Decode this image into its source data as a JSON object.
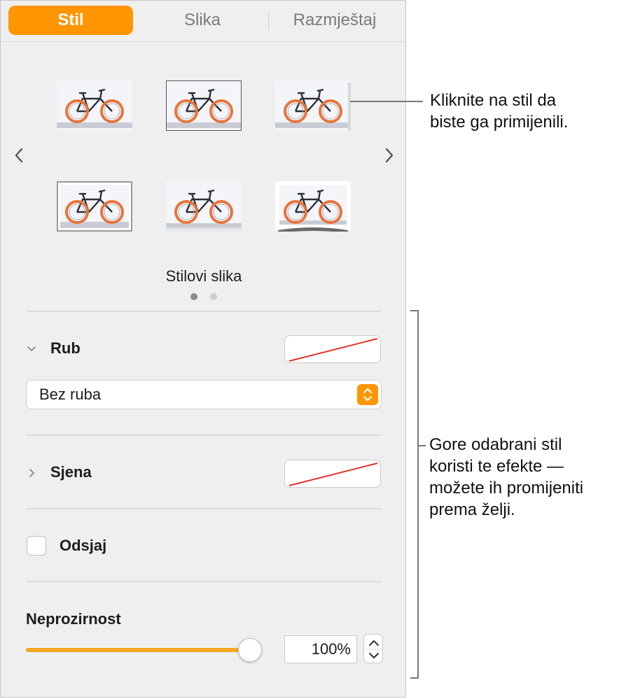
{
  "tabs": [
    {
      "label": "Stil",
      "active": true
    },
    {
      "label": "Slika",
      "active": false
    },
    {
      "label": "Razmještaj",
      "active": false
    }
  ],
  "style_gallery": {
    "label": "Stilovi slika",
    "page_count": 2,
    "current_page": 1,
    "styles": [
      "no-border",
      "thin-border",
      "shadow",
      "frame",
      "reflection",
      "curled-shadow"
    ]
  },
  "border": {
    "title": "Rub",
    "expanded": true,
    "select_value": "Bez ruba"
  },
  "shadow": {
    "title": "Sjena",
    "expanded": false
  },
  "reflection": {
    "label": "Odsjaj",
    "checked": false
  },
  "opacity": {
    "title": "Neprozirnost",
    "value_text": "100%",
    "level": 1.0
  },
  "callouts": {
    "style_line1": "Kliknite na stil da",
    "style_line2": "biste ga primijenili.",
    "effects_line1": "Gore odabrani stil",
    "effects_line2": "koristi te efekte —",
    "effects_line3": "možete ih promijeniti",
    "effects_line4": "prema želji."
  },
  "colors": {
    "accent": "#ff9500",
    "bike_tire": "#e8743b"
  }
}
